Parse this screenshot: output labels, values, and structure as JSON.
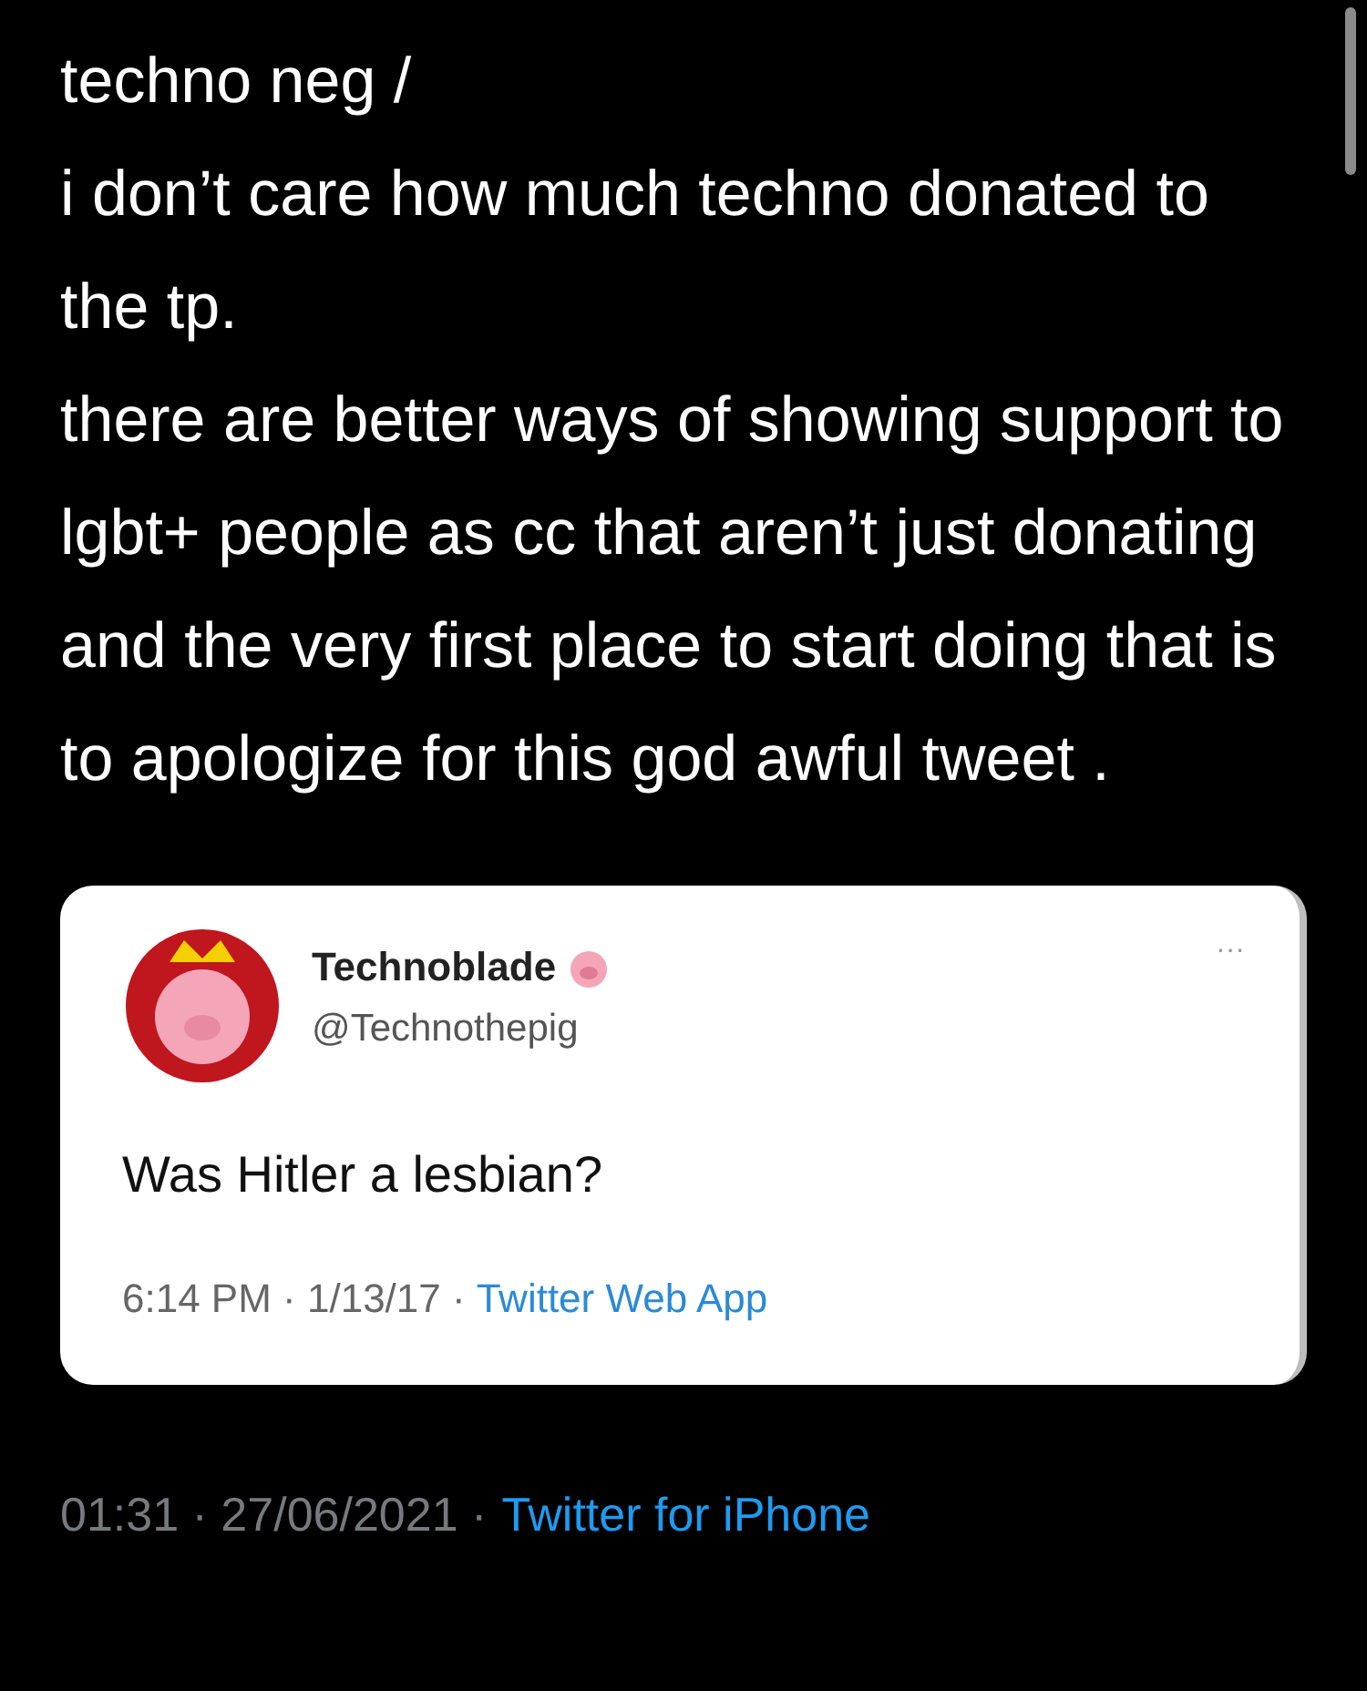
{
  "tweet": {
    "paragraphs": [
      "techno neg /",
      "i don’t care how much techno donated to the tp.",
      "there are better ways of showing support to lgbt+ people as cc that aren’t just donating and the very first place to start doing that is to apologize for this god awful tweet ."
    ],
    "quoted": {
      "name": "Technoblade",
      "handle": "@Technothepig",
      "more": "···",
      "text": "Was Hitler a lesbian?",
      "meta": "6:14 PM · 1/13/17 ·",
      "source": "Twitter Web App"
    },
    "meta": "01:31 · 27/06/2021 ·",
    "source": "Twitter for iPhone"
  }
}
